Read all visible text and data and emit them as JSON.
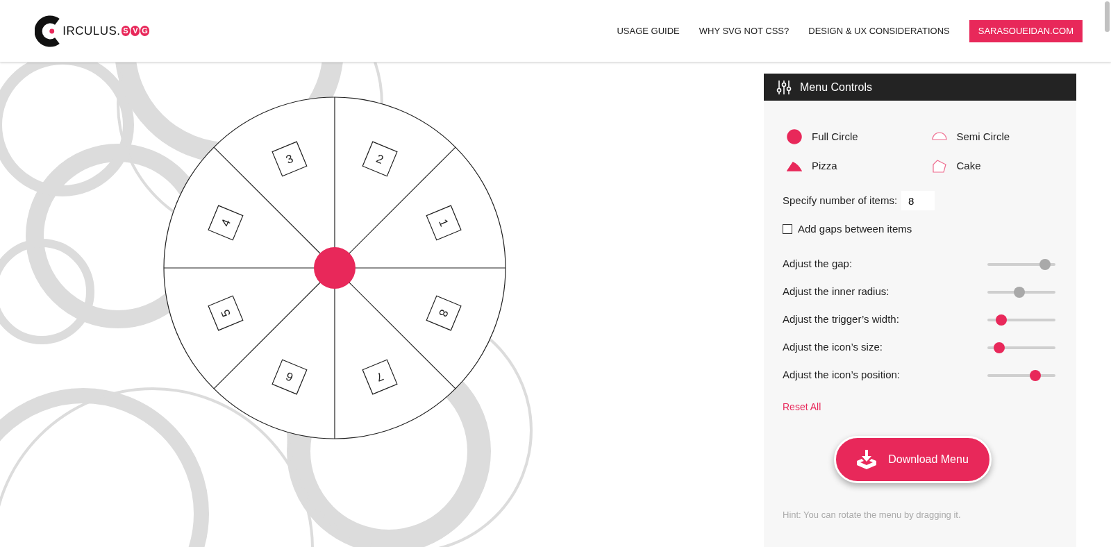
{
  "logo": {
    "wordmark": "IRCULUS.",
    "badge_letters": [
      "S",
      "V",
      "G"
    ]
  },
  "nav": [
    {
      "label": "USAGE GUIDE",
      "highlighted": false
    },
    {
      "label": "WHY SVG NOT CSS?",
      "highlighted": false
    },
    {
      "label": "DESIGN & UX CONSIDERATIONS",
      "highlighted": false
    },
    {
      "label": "SARASOUEIDAN.COM",
      "highlighted": true
    }
  ],
  "menu": {
    "items": [
      "1",
      "2",
      "3",
      "4",
      "5",
      "6",
      "7",
      "8"
    ]
  },
  "panel": {
    "title": "Menu Controls",
    "shape_options": [
      {
        "kind": "full-circle",
        "label": "Full Circle",
        "selected": true
      },
      {
        "kind": "semi-circle",
        "label": "Semi Circle",
        "selected": false
      },
      {
        "kind": "pizza",
        "label": "Pizza",
        "selected": true
      },
      {
        "kind": "cake",
        "label": "Cake",
        "selected": false
      }
    ],
    "item_count": {
      "label": "Specify number of items:",
      "value": "8"
    },
    "gaps_checkbox": {
      "label": "Add gaps between items",
      "checked": false
    },
    "sliders": [
      {
        "label": "Adjust the gap:",
        "level": 0.85,
        "disabled": true
      },
      {
        "label": "Adjust the inner radius:",
        "level": 0.47,
        "disabled": true
      },
      {
        "label": "Adjust the trigger’s width:",
        "level": 0.2,
        "disabled": false
      },
      {
        "label": "Adjust the icon’s size:",
        "level": 0.17,
        "disabled": false
      },
      {
        "label": "Adjust the icon’s position:",
        "level": 0.7,
        "disabled": false
      }
    ],
    "reset_link": "Reset All",
    "download_button": "Download Menu",
    "hint": "Hint: You can rotate the menu by dragging it."
  }
}
